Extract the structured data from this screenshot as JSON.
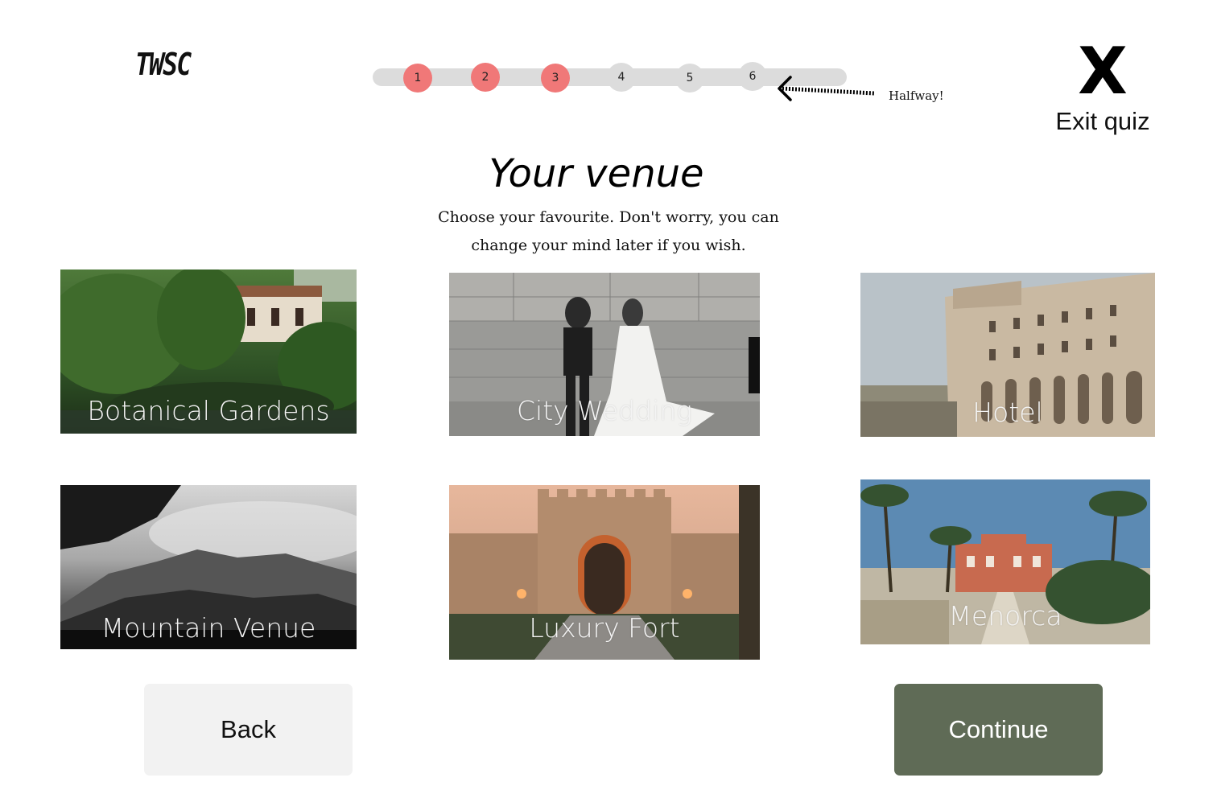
{
  "header": {
    "logo_text": "TWSC",
    "exit_label": "Exit quiz",
    "exit_glyph": "X"
  },
  "progress": {
    "steps": [
      {
        "label": "1",
        "completed": true
      },
      {
        "label": "2",
        "completed": true
      },
      {
        "label": "3",
        "completed": true
      },
      {
        "label": "4",
        "completed": false
      },
      {
        "label": "5",
        "completed": false
      },
      {
        "label": "6",
        "completed": false
      }
    ],
    "annotation": "Halfway!",
    "colors": {
      "completed": "#f07878",
      "pending": "#dcdcdc"
    }
  },
  "main": {
    "title": "Your venue",
    "subtitle": "Choose your favourite. Don't worry, you can change your mind later if you wish."
  },
  "venues": [
    {
      "label": "Botanical Gardens"
    },
    {
      "label": "City Wedding"
    },
    {
      "label": "Hotel"
    },
    {
      "label": "Mountain Venue"
    },
    {
      "label": "Luxury Fort"
    },
    {
      "label": "Menorca"
    }
  ],
  "footer": {
    "back_label": "Back",
    "continue_label": "Continue",
    "continue_color": "#5f6b56"
  }
}
